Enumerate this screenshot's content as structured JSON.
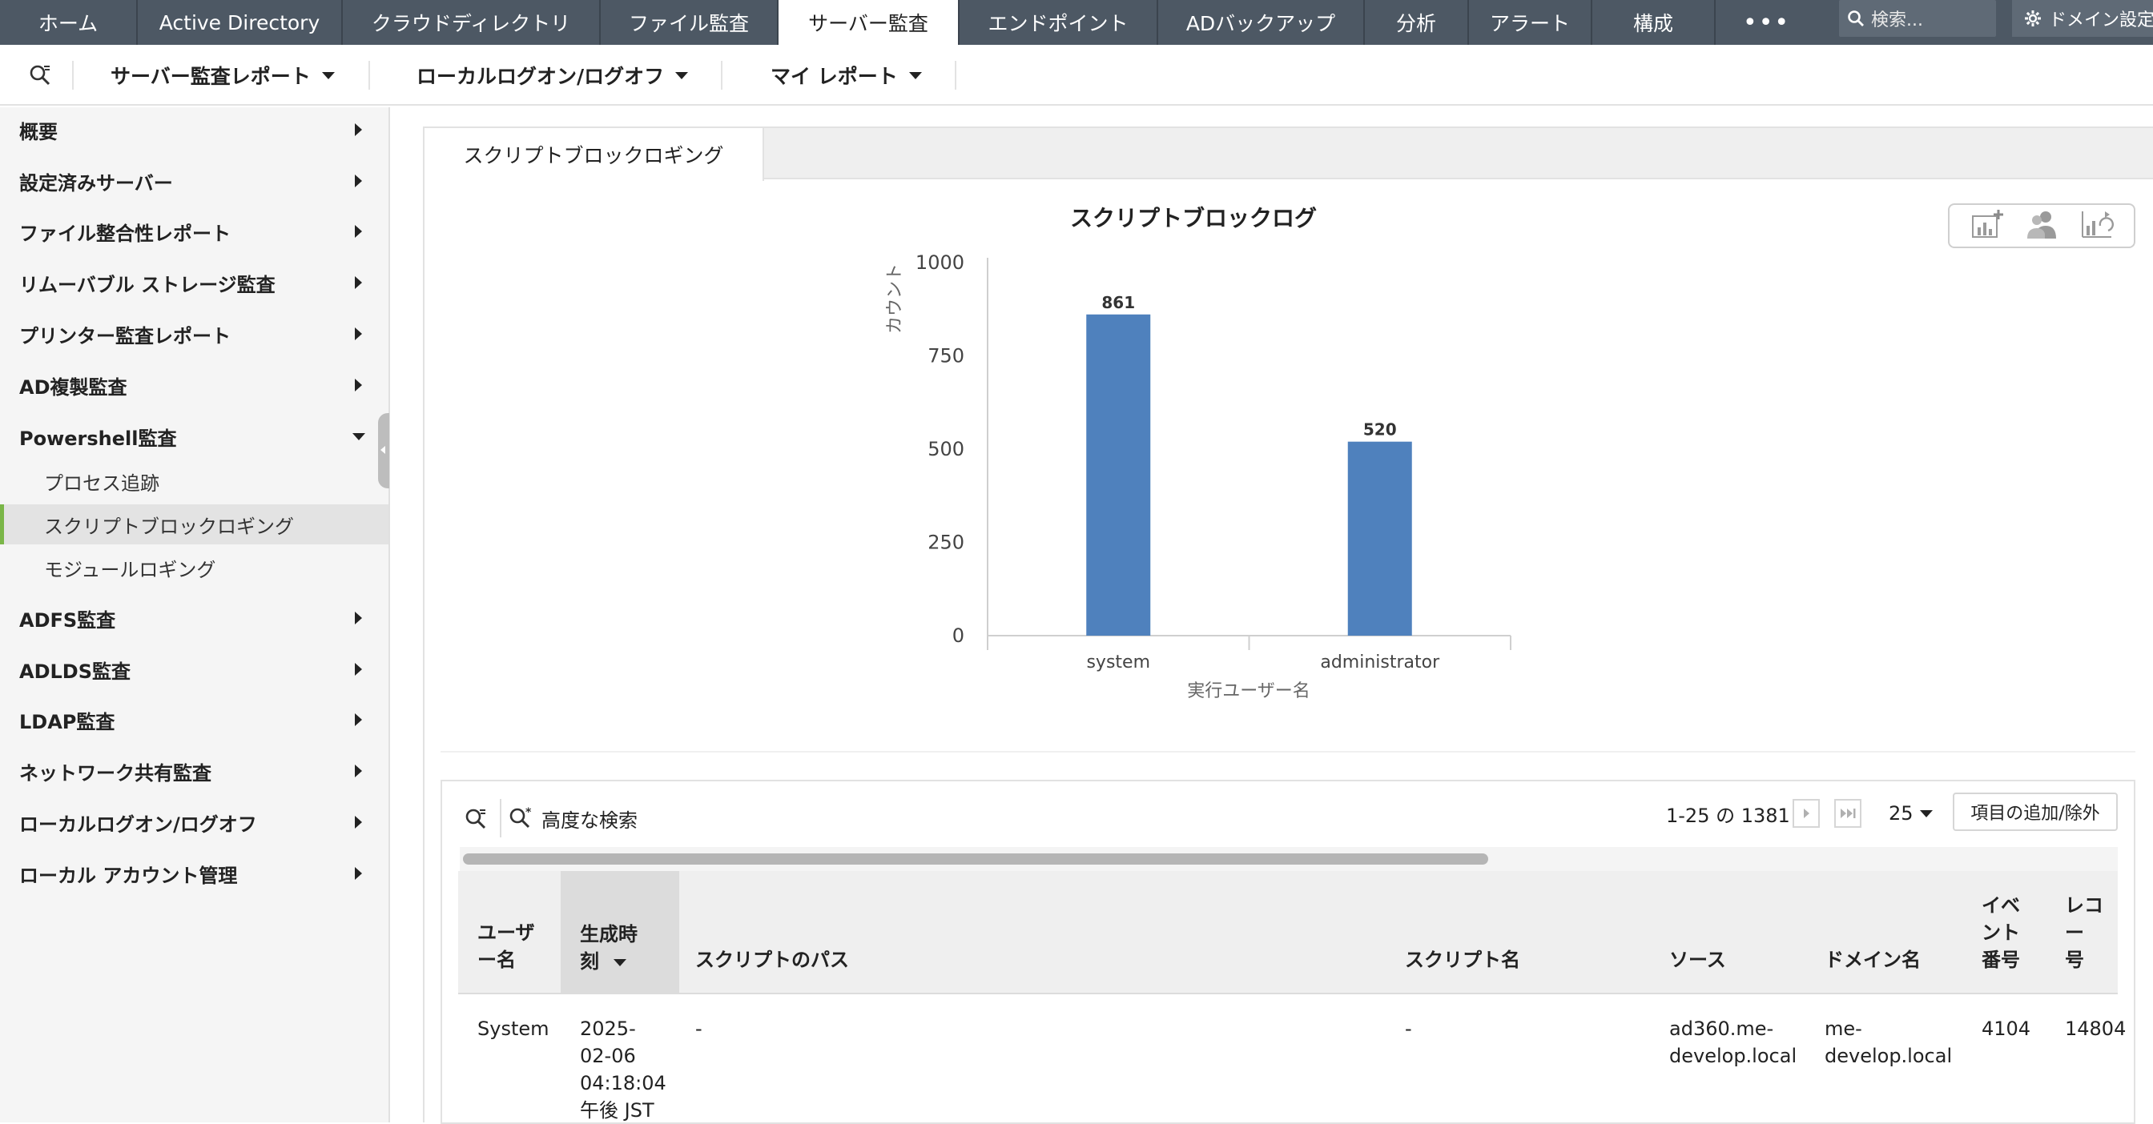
{
  "topnav": {
    "tabs": [
      {
        "label": "ホーム"
      },
      {
        "label": "Active Directory"
      },
      {
        "label": "クラウドディレクトリ"
      },
      {
        "label": "ファイル監査"
      },
      {
        "label": "サーバー監査",
        "active": true
      },
      {
        "label": "エンドポイント"
      },
      {
        "label": "ADバックアップ"
      },
      {
        "label": "分析"
      },
      {
        "label": "アラート"
      },
      {
        "label": "構成"
      }
    ],
    "more_label": "•••",
    "search_placeholder": "検索...",
    "settings_label": "ドメイン設定"
  },
  "subnav": {
    "menus": [
      "サーバー監査レポート",
      "ローカルログオン/ログオフ",
      "マイ レポート"
    ]
  },
  "sidebar": {
    "groups_before": [
      "概要",
      "設定済みサーバー",
      "ファイル整合性レポート",
      "リムーバブル ストレージ監査",
      "プリンター監査レポート",
      "AD複製監査"
    ],
    "expanded_group": "Powershell監査",
    "sub_items": [
      "プロセス追跡",
      "スクリプトブロックロギング",
      "モジュールロギング"
    ],
    "active_sub_index": 1,
    "groups_after": [
      "ADFS監査",
      "ADLDS監査",
      "LDAP監査",
      "ネットワーク共有監査",
      "ローカルログオン/ログオフ",
      "ローカル アカウント管理"
    ]
  },
  "main": {
    "tab_label": "スクリプトブロックロギング",
    "chart_tools": [
      "add-chart-icon",
      "users-icon",
      "chart-refresh-icon"
    ]
  },
  "chart_data": {
    "type": "bar",
    "title": "スクリプトブロックログ",
    "xlabel": "実行ユーザー名",
    "ylabel": "カウント",
    "categories": [
      "system",
      "administrator"
    ],
    "values": [
      861,
      520
    ],
    "yticks": [
      0,
      250,
      500,
      750,
      1000
    ],
    "ylim": [
      0,
      1000
    ],
    "bar_color": "#4f81bd",
    "grid": false
  },
  "grid": {
    "advanced_search_label": "高度な検索",
    "page_info": "1-25 の 1381",
    "page_size": "25",
    "columns_button": "項目の追加/除外",
    "columns": [
      "ユーザ\nー名",
      "生成時\n刻",
      "スクリプトのパス",
      "スクリプト名",
      "ソース",
      "ドメイン名",
      "イベ\nント\n番号",
      "レコー\n号"
    ],
    "rows": [
      [
        "System",
        "2025-\n02-06\n04:18:04\n午後 JST",
        "-",
        "-",
        "ad360.me-\ndevelop.local",
        "me-\ndevelop.local",
        "4104",
        "14804"
      ]
    ]
  }
}
